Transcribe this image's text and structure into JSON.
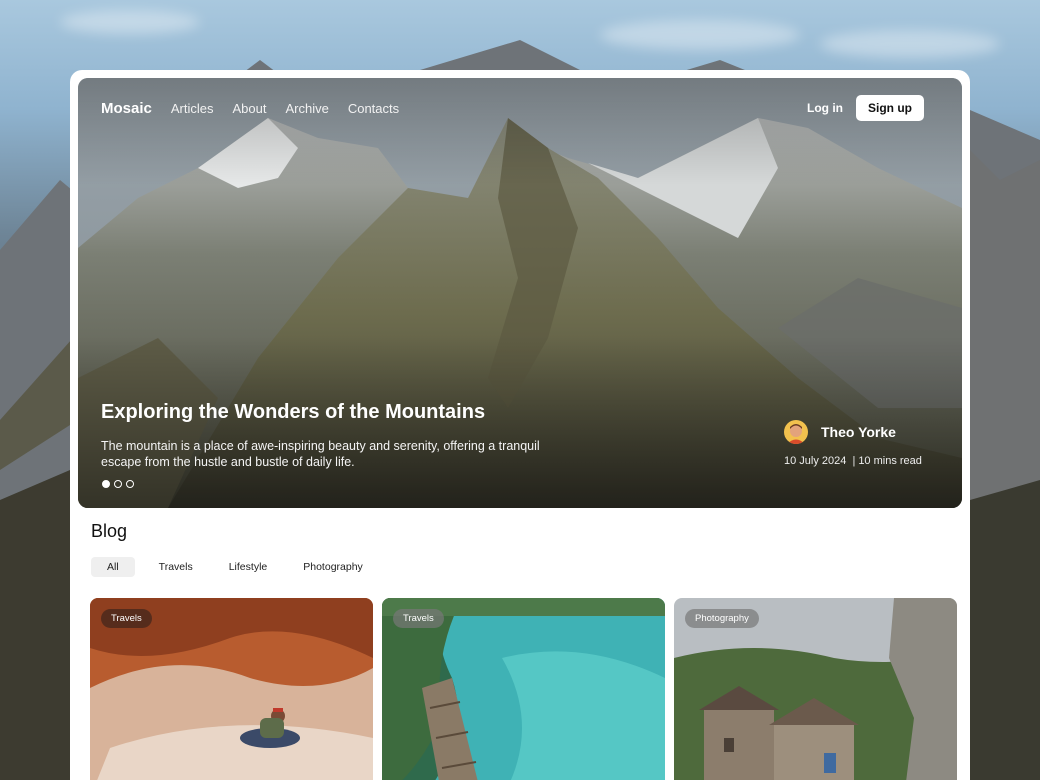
{
  "nav": {
    "brand": "Mosaic",
    "links": [
      "Articles",
      "About",
      "Archive",
      "Contacts"
    ],
    "login": "Log in",
    "signup": "Sign up"
  },
  "hero": {
    "title": "Exploring the Wonders of the Mountains",
    "description": "The mountain is a place of awe-inspiring beauty and serenity, offering a tranquil escape from the hustle and bustle of daily life.",
    "author": "Theo Yorke",
    "date": "10 July 2024",
    "separator": "|",
    "read_time": "10 mins read",
    "slides_total": 3,
    "slide_active": 1
  },
  "blog": {
    "title": "Blog",
    "filters": [
      "All",
      "Travels",
      "Lifestyle",
      "Photography"
    ],
    "active_filter": "All",
    "cards": [
      {
        "tag": "Travels",
        "image": "red-canyon-person"
      },
      {
        "tag": "Travels",
        "image": "turquoise-river-boardwalk"
      },
      {
        "tag": "Photography",
        "image": "stone-village-cliff"
      }
    ]
  },
  "colors": {
    "page_bg": "#ffffff",
    "signup_bg": "#ffffff",
    "chip_active_bg": "#efefef"
  }
}
